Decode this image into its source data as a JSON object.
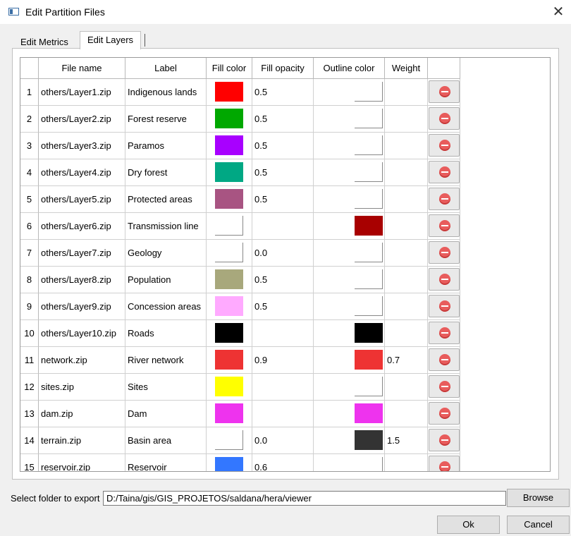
{
  "window": {
    "title": "Edit Partition Files"
  },
  "tabs": [
    {
      "label": "Edit Metrics"
    },
    {
      "label": "Edit Layers"
    }
  ],
  "table": {
    "headers": [
      "File name",
      "Label",
      "Fill color",
      "Fill opacity",
      "Outline color",
      "Weight"
    ],
    "rows": [
      {
        "num": "1",
        "file": "others/Layer1.zip",
        "label": "Indigenous lands",
        "fill": "#ff0000",
        "opacity": "0.5",
        "outline": null,
        "weight": ""
      },
      {
        "num": "2",
        "file": "others/Layer2.zip",
        "label": "Forest reserve",
        "fill": "#00a800",
        "opacity": "0.5",
        "outline": null,
        "weight": ""
      },
      {
        "num": "3",
        "file": "others/Layer3.zip",
        "label": "Paramos",
        "fill": "#a800ff",
        "opacity": "0.5",
        "outline": null,
        "weight": ""
      },
      {
        "num": "4",
        "file": "others/Layer4.zip",
        "label": "Dry forest",
        "fill": "#00a884",
        "opacity": "0.5",
        "outline": null,
        "weight": ""
      },
      {
        "num": "5",
        "file": "others/Layer5.zip",
        "label": "Protected areas",
        "fill": "#a85482",
        "opacity": "0.5",
        "outline": null,
        "weight": ""
      },
      {
        "num": "6",
        "file": "others/Layer6.zip",
        "label": "Transmission line",
        "fill": null,
        "opacity": "",
        "outline": "#a80000",
        "weight": ""
      },
      {
        "num": "7",
        "file": "others/Layer7.zip",
        "label": "Geology",
        "fill": null,
        "opacity": "0.0",
        "outline": null,
        "weight": ""
      },
      {
        "num": "8",
        "file": "others/Layer8.zip",
        "label": "Population",
        "fill": "#a8a87c",
        "opacity": "0.5",
        "outline": null,
        "weight": ""
      },
      {
        "num": "9",
        "file": "others/Layer9.zip",
        "label": "Concession areas",
        "fill": "#ffaaff",
        "opacity": "0.5",
        "outline": null,
        "weight": ""
      },
      {
        "num": "10",
        "file": "others/Layer10.zip",
        "label": "Roads",
        "fill": "#000000",
        "opacity": "",
        "outline": "#000000",
        "weight": ""
      },
      {
        "num": "11",
        "file": "network.zip",
        "label": "River network",
        "fill": "#ee3333",
        "opacity": "0.9",
        "outline": "#ee3333",
        "weight": "0.7"
      },
      {
        "num": "12",
        "file": "sites.zip",
        "label": "Sites",
        "fill": "#ffff00",
        "opacity": "",
        "outline": null,
        "weight": ""
      },
      {
        "num": "13",
        "file": "dam.zip",
        "label": "Dam",
        "fill": "#ee33ee",
        "opacity": "",
        "outline": "#ee33ee",
        "weight": ""
      },
      {
        "num": "14",
        "file": "terrain.zip",
        "label": "Basin area",
        "fill": null,
        "opacity": "0.0",
        "outline": "#333333",
        "weight": "1.5"
      },
      {
        "num": "15",
        "file": "reservoir.zip",
        "label": "Reservoir",
        "fill": "#3377ff",
        "opacity": "0.6",
        "outline": null,
        "weight": ""
      }
    ],
    "delete_icon": "remove-circle-icon"
  },
  "export": {
    "label": "Select folder to export",
    "path": "D:/Taina/gis/GIS_PROJETOS/saldana/hera/viewer",
    "browse_label": "Browse"
  },
  "buttons": {
    "ok": "Ok",
    "cancel": "Cancel"
  }
}
